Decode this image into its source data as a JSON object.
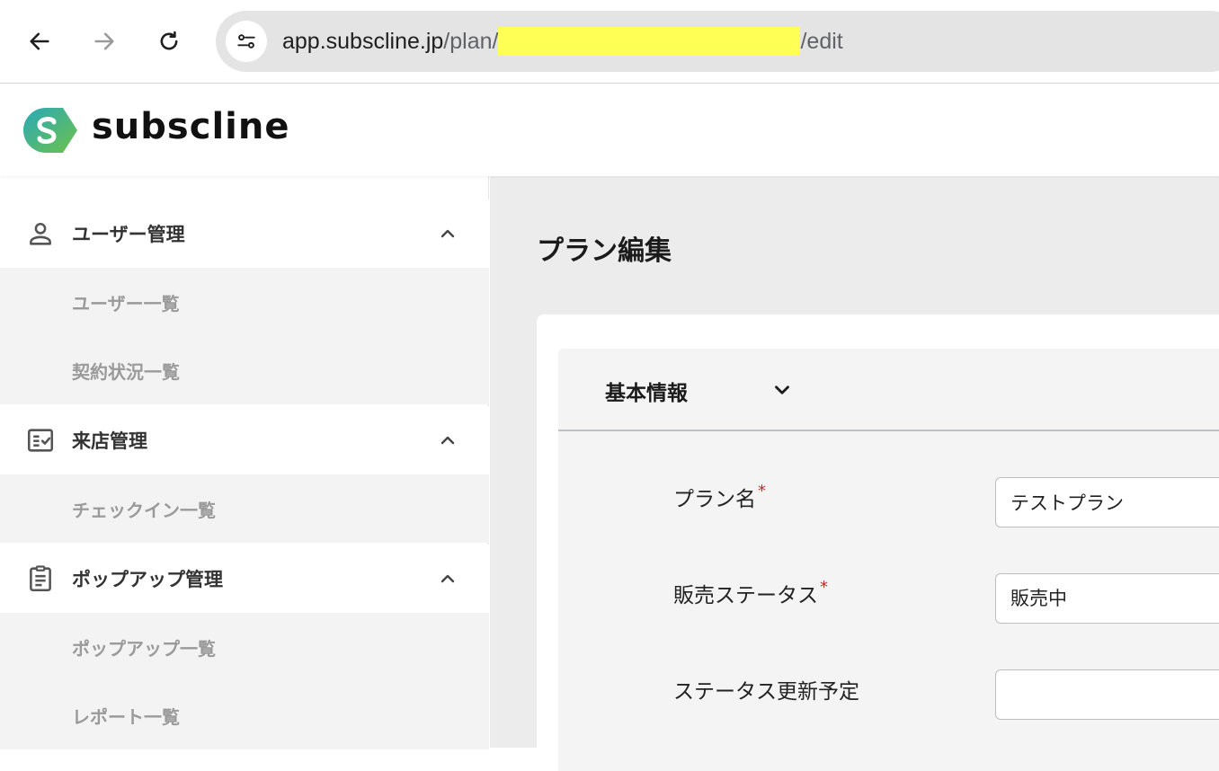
{
  "browser": {
    "url_host": "app.subscline.jp",
    "url_path_prefix": "/plan/",
    "url_path_suffix": "/edit"
  },
  "app": {
    "logo_text": "subscline"
  },
  "sidebar": {
    "groups": [
      {
        "label": "ユーザー管理",
        "items": [
          "ユーザー一覧",
          "契約状況一覧"
        ]
      },
      {
        "label": "来店管理",
        "items": [
          "チェックイン一覧"
        ]
      },
      {
        "label": "ポップアップ管理",
        "items": [
          "ポップアップ一覧",
          "レポート一覧"
        ]
      }
    ]
  },
  "main": {
    "page_title": "プラン編集",
    "section_title": "基本情報",
    "required_mark": "*",
    "fields": [
      {
        "label": "プラン名",
        "required": true,
        "value": "テストプラン"
      },
      {
        "label": "販売ステータス",
        "required": true,
        "value": "販売中"
      },
      {
        "label": "ステータス更新予定",
        "required": false,
        "value": ""
      }
    ]
  },
  "colors": {
    "logo_gradient_start": "#2bb5a0",
    "logo_gradient_end": "#6cc24a",
    "required": "#c62828",
    "redaction": "#ffff55"
  }
}
